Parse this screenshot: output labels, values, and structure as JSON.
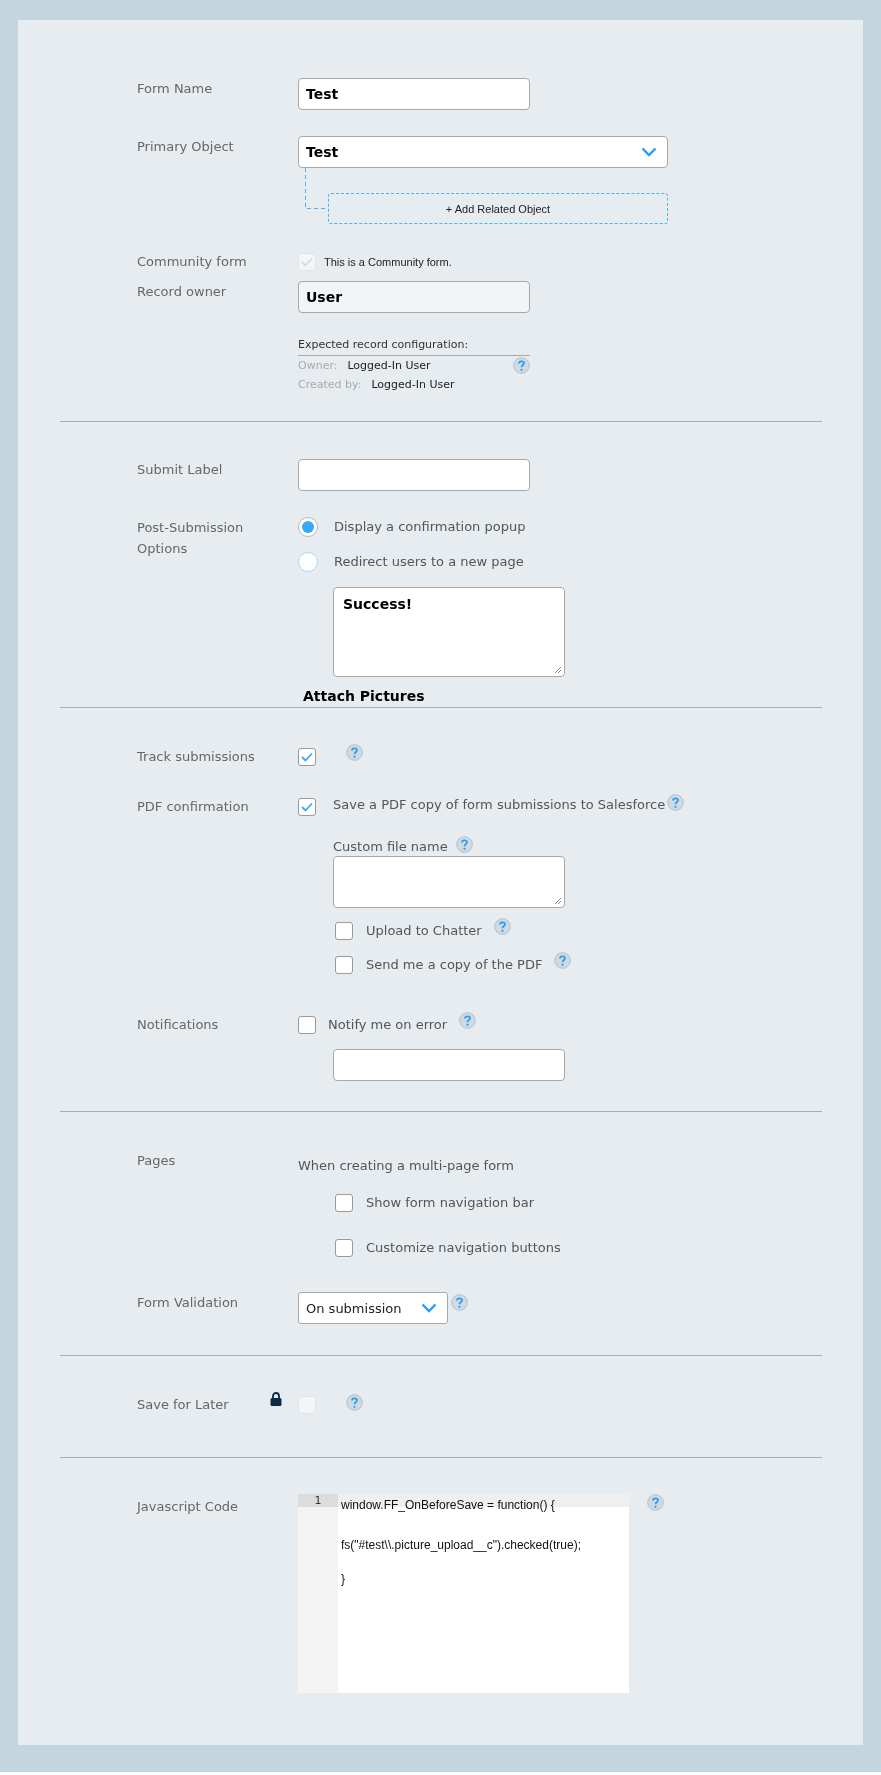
{
  "form_name": {
    "label": "Form Name",
    "value": "Test"
  },
  "primary_object": {
    "label": "Primary Object",
    "value": "Test",
    "add_related": "+ Add Related Object"
  },
  "community_form": {
    "label": "Community form",
    "checkbox_label": "This is a Community form.",
    "checked": true,
    "disabled": true
  },
  "record_owner": {
    "label": "Record owner",
    "value": "User",
    "disabled": true
  },
  "expected_config": {
    "title": "Expected record configuration:",
    "rows": [
      {
        "key": "Owner:",
        "value": "Logged-In User"
      },
      {
        "key": "Created by:",
        "value": "Logged-In User"
      }
    ]
  },
  "submit_label": {
    "label": "Submit Label"
  },
  "post_submission": {
    "label": "Post-Submission Options",
    "options": [
      {
        "label": "Display a confirmation popup",
        "selected": true
      },
      {
        "label": "Redirect users to a new page",
        "selected": false
      }
    ],
    "message": "Success!",
    "heading": "Attach Pictures"
  },
  "track_submissions": {
    "label": "Track submissions",
    "checked": true
  },
  "pdf_confirmation": {
    "label": "PDF confirmation",
    "checkbox_label": "Save a PDF copy of form submissions to Salesforce",
    "checked": true,
    "file_name_label": "Custom file name",
    "options": [
      {
        "label": "Upload to Chatter",
        "checked": false
      },
      {
        "label": "Send me a copy of the PDF",
        "checked": false
      }
    ]
  },
  "notifications": {
    "label": "Notifications",
    "checkbox_label": "Notify me on error",
    "checked": false
  },
  "pages": {
    "label": "Pages",
    "intro": "When creating a multi-page form",
    "options": [
      {
        "label": "Show form navigation bar",
        "checked": false
      },
      {
        "label": "Customize navigation buttons",
        "checked": false
      }
    ]
  },
  "form_validation": {
    "label": "Form Validation",
    "value": "On submission"
  },
  "save_for_later": {
    "label": "Save for Later",
    "locked": true,
    "checked": false,
    "disabled": true
  },
  "javascript_code": {
    "label": "Javascript Code",
    "line_numbers": [
      "1"
    ],
    "lines": [
      "window.FF_OnBeforeSave = function() {",
      "fs(\"#test\\\\.picture_upload__c\").checked(true);",
      "}"
    ]
  }
}
